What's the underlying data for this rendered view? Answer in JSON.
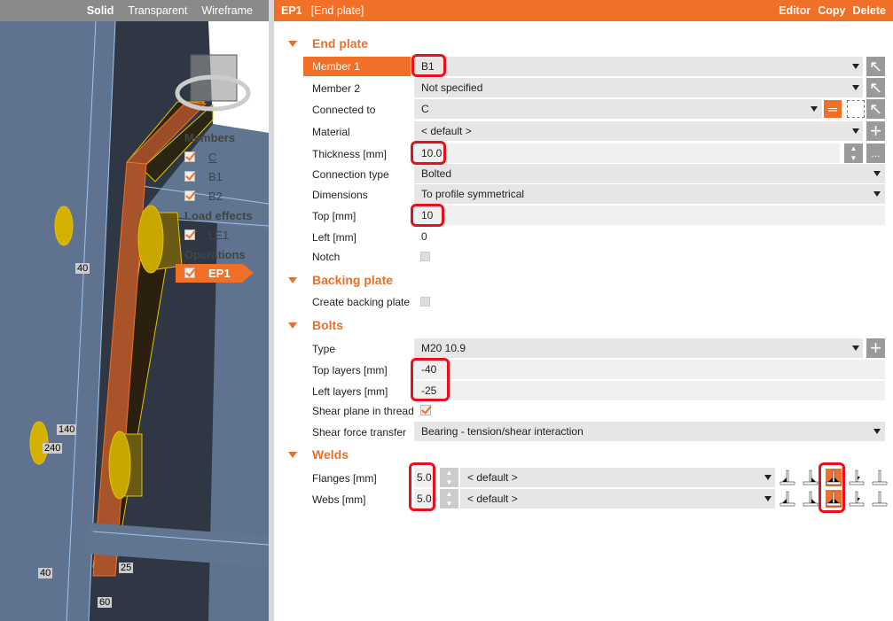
{
  "view": {
    "modes": [
      "Solid",
      "Transparent",
      "Wireframe"
    ],
    "active_mode": "Solid",
    "tree": {
      "groups": [
        {
          "label": "Members",
          "items": [
            "C",
            "B1",
            "B2"
          ]
        },
        {
          "label": "Load effects",
          "items": [
            "LE1"
          ]
        },
        {
          "label": "Operations",
          "items": [
            "EP1"
          ]
        }
      ]
    },
    "dimensions": [
      "40",
      "140",
      "240",
      "25",
      "40",
      "60"
    ]
  },
  "header": {
    "id": "EP1",
    "title": "[End plate]",
    "actions": [
      "Editor",
      "Copy",
      "Delete"
    ]
  },
  "sections": {
    "end_plate": "End plate",
    "backing_plate": "Backing plate",
    "bolts": "Bolts",
    "welds": "Welds"
  },
  "end_plate": {
    "member1": {
      "label": "Member 1",
      "value": "B1"
    },
    "member2": {
      "label": "Member 2",
      "value": "Not specified"
    },
    "connected_to": {
      "label": "Connected to",
      "value": "C"
    },
    "material": {
      "label": "Material",
      "value": "< default >"
    },
    "thickness": {
      "label": "Thickness [mm]",
      "value": "10.0",
      "more": "..."
    },
    "connection_type": {
      "label": "Connection type",
      "value": "Bolted"
    },
    "dimensions": {
      "label": "Dimensions",
      "value": "To profile symmetrical"
    },
    "top": {
      "label": "Top [mm]",
      "value": "10"
    },
    "left": {
      "label": "Left [mm]",
      "value": "0"
    },
    "notch": {
      "label": "Notch",
      "checked": false
    }
  },
  "backing_plate": {
    "create": {
      "label": "Create backing plate",
      "checked": false
    }
  },
  "bolts": {
    "type": {
      "label": "Type",
      "value": "M20 10.9"
    },
    "top_layers": {
      "label": "Top layers [mm]",
      "value": "-40"
    },
    "left_layers": {
      "label": "Left layers [mm]",
      "value": "-25"
    },
    "shear_plane": {
      "label": "Shear plane in thread",
      "checked": true
    },
    "shear_force": {
      "label": "Shear force transfer",
      "value": "Bearing - tension/shear interaction"
    }
  },
  "welds": {
    "flanges": {
      "label": "Flanges [mm]",
      "value": "5.0",
      "type": "< default >",
      "selected_icon": 3
    },
    "webs": {
      "label": "Webs [mm]",
      "value": "5.0",
      "type": "< default >",
      "selected_icon": 3
    }
  },
  "colors": {
    "accent": "#f07028",
    "highlight": "#e8101a"
  }
}
